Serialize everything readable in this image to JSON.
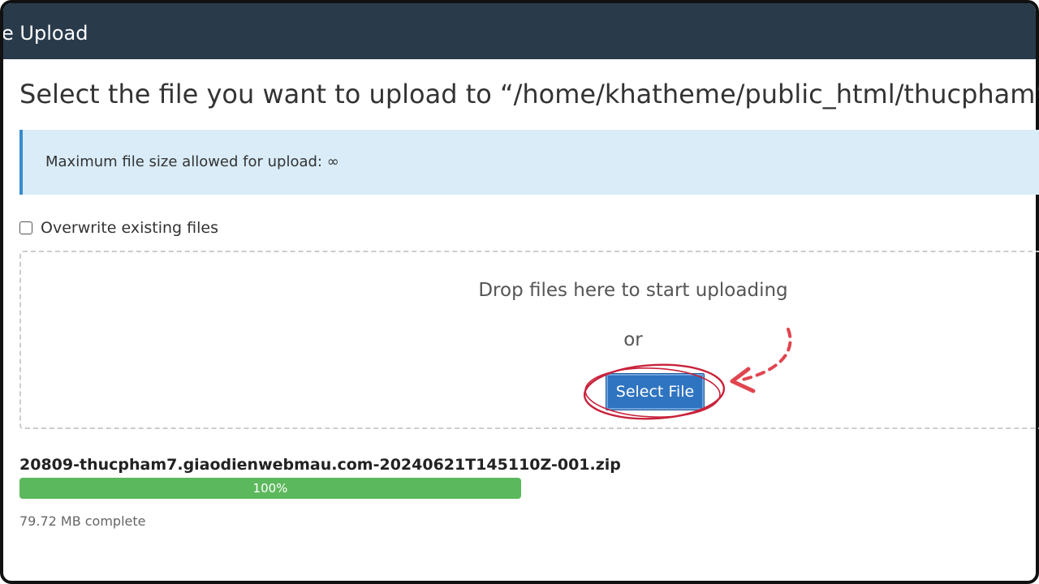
{
  "header": {
    "title": "e Upload"
  },
  "page": {
    "title": "Select the file you want to upload to “/home/khatheme/public_html/thucpham”."
  },
  "alert": {
    "text": "Maximum file size allowed for upload: ∞",
    "bg_color": "#d9ecf8",
    "border_color": "#3a8ccc"
  },
  "options": {
    "overwrite_label": "Overwrite existing files",
    "overwrite_checked": false
  },
  "dropzone": {
    "drop_text": "Drop files here to start uploading",
    "or_text": "or",
    "select_button_label": "Select File"
  },
  "upload": {
    "file_name": "20809-thucpham7.giaodienwebmau.com-20240621T145110Z-001.zip",
    "progress_percent": 100,
    "progress_label": "100%",
    "status": "79.72 MB complete"
  },
  "colors": {
    "header_bg": "#293a4b",
    "button_bg": "#2f74c0",
    "progress_fill": "#5cb85c",
    "annotation": "#e0454f"
  }
}
